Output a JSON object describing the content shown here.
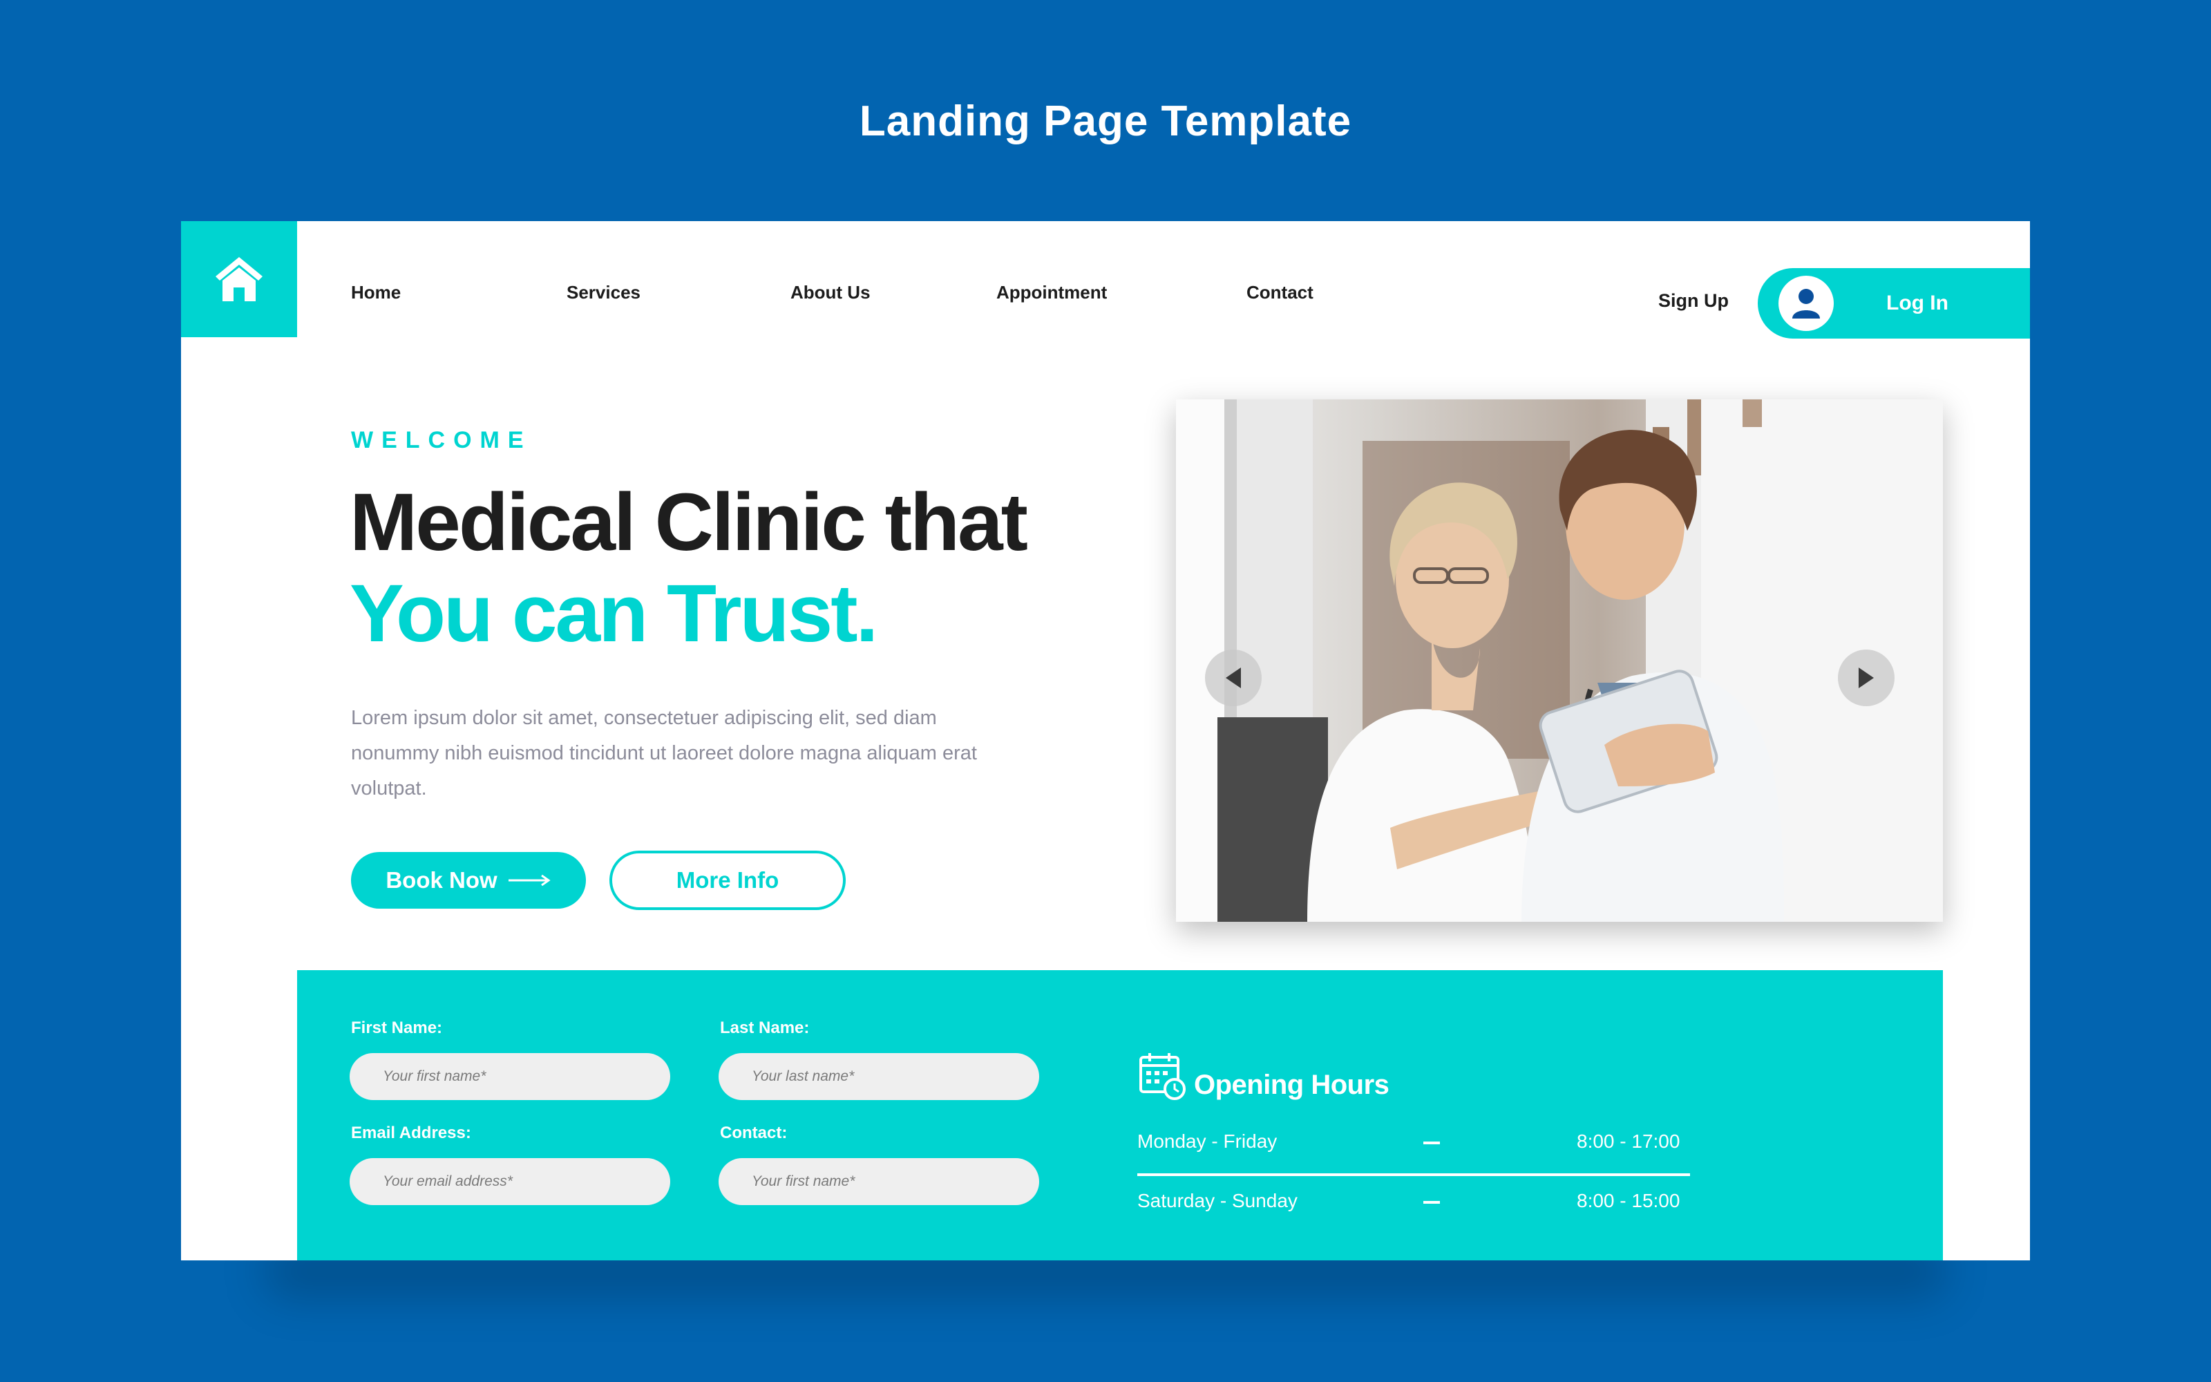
{
  "page": {
    "title": "Landing Page Template"
  },
  "nav": {
    "items": [
      "Home",
      "Services",
      "About Us",
      "Appointment",
      "Contact"
    ],
    "signup_label": "Sign Up",
    "login_label": "Log In"
  },
  "hero": {
    "eyebrow": "WELCOME",
    "headline_line1": "Medical Clinic that",
    "headline_line2": "You can Trust.",
    "body": "Lorem ipsum dolor sit amet, consectetuer adipiscing elit, sed diam nonummy nibh euismod tincidunt ut laoreet dolore magna aliquam erat volutpat.",
    "book_button": "Book Now",
    "more_button": "More Info"
  },
  "form": {
    "first_name_label": "First Name:",
    "first_name_placeholder": "Your first name*",
    "last_name_label": "Last Name:",
    "last_name_placeholder": "Your last name*",
    "email_label": "Email Address:",
    "email_placeholder": "Your email address*",
    "contact_label": "Contact:",
    "contact_placeholder": "Your first name*"
  },
  "opening_hours": {
    "title": "Opening Hours",
    "rows": [
      {
        "days": "Monday - Friday",
        "hours": "8:00 - 17:00"
      },
      {
        "days": "Saturday - Sunday",
        "hours": "8:00 - 15:00"
      }
    ]
  },
  "colors": {
    "background": "#0264b0",
    "accent": "#00d4d0",
    "heading": "#1e1e1e",
    "body_text": "#8c8c9a"
  },
  "icons": {
    "logo": "home-icon",
    "avatar": "user-icon",
    "prev": "chevron-left-icon",
    "next": "chevron-right-icon",
    "arrow": "arrow-right-icon",
    "calendar": "calendar-clock-icon"
  }
}
